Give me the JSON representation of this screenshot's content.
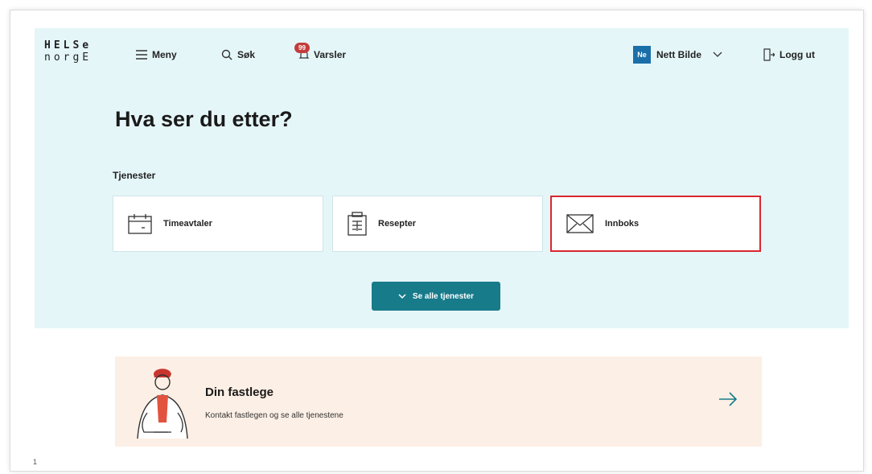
{
  "header": {
    "logo_line1": "HELSe",
    "logo_line2": "norgE",
    "menu_label": "Meny",
    "search_label": "Søk",
    "alerts_label": "Varsler",
    "alerts_badge": "99",
    "user_initials": "Ne",
    "user_name": "Nett Bilde",
    "logout_label": "Logg ut"
  },
  "hero": {
    "title": "Hva ser du etter?",
    "section_label": "Tjenester",
    "services": [
      {
        "label": "Timeavtaler",
        "icon": "calendar-icon"
      },
      {
        "label": "Resepter",
        "icon": "prescription-icon"
      },
      {
        "label": "Innboks",
        "icon": "envelope-icon",
        "selected": true
      }
    ],
    "see_all_label": "Se alle tjenester"
  },
  "gp": {
    "title": "Din fastlege",
    "subtitle": "Kontakt fastlegen og se alle tjenestene"
  },
  "footer": {
    "mark": "1"
  },
  "colors": {
    "hero_bg": "#e5f6f9",
    "accent": "#187b8a",
    "highlight": "#d9272e",
    "gp_bg": "#fcefe5",
    "avatar": "#1b6fa8"
  }
}
